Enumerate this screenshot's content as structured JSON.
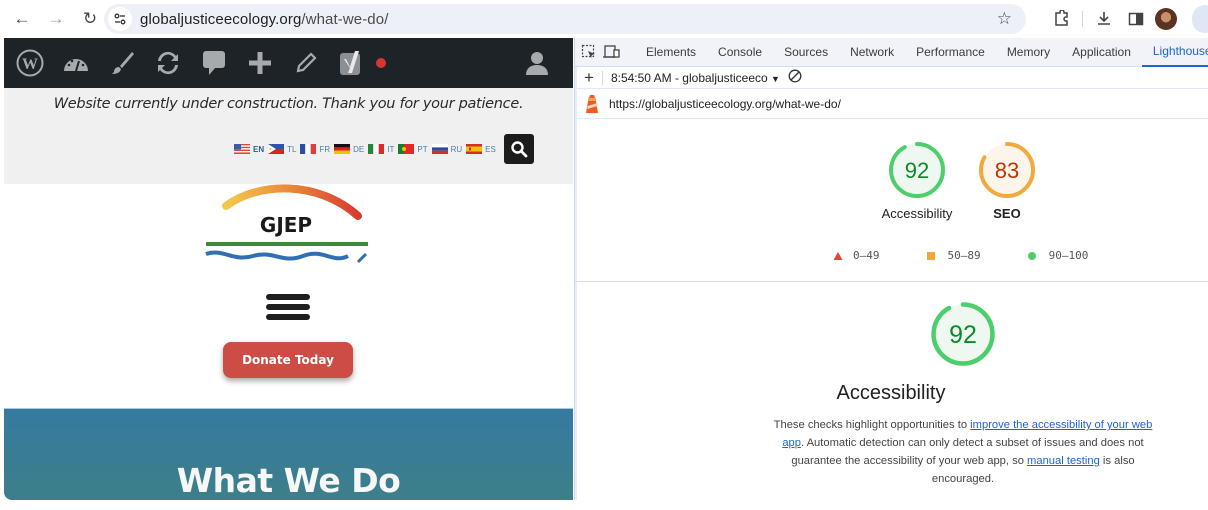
{
  "browser": {
    "url_domain": "globaljusticeecology.org",
    "url_path": "/what-we-do/",
    "icons": [
      "back-icon",
      "forward-icon",
      "reload-icon",
      "site-info-icon",
      "bookmark-star-icon",
      "extensions-icon",
      "download-icon",
      "side-panel-icon",
      "profile-avatar"
    ]
  },
  "page": {
    "admin_bar_icons": [
      "wordpress-icon",
      "dashboard-icon",
      "customize-brush-icon",
      "updates-icon",
      "comments-icon",
      "new-plus-icon",
      "edit-pencil-icon",
      "yoast-seo-icon",
      "seo-status-dot",
      "user-icon"
    ],
    "notice": "Website currently under construction. Thank you for your patience.",
    "languages": [
      {
        "code": "EN",
        "flag": "us-flag-icon",
        "active": true
      },
      {
        "code": "TL",
        "flag": "ph-flag-icon",
        "active": false
      },
      {
        "code": "FR",
        "flag": "fr-flag-icon",
        "active": false
      },
      {
        "code": "DE",
        "flag": "de-flag-icon",
        "active": false
      },
      {
        "code": "IT",
        "flag": "it-flag-icon",
        "active": false
      },
      {
        "code": "PT",
        "flag": "pt-flag-icon",
        "active": false
      },
      {
        "code": "RU",
        "flag": "ru-flag-icon",
        "active": false
      },
      {
        "code": "ES",
        "flag": "es-flag-icon",
        "active": false
      }
    ],
    "logo_text": "GJEP",
    "donate_label": "Donate Today",
    "hero_title": "What We Do",
    "colors": {
      "donate": "#cd4c45",
      "hero_top": "#367aa0",
      "hero_bottom": "#3d7f87",
      "admin_bar": "#1d2327"
    }
  },
  "devtools": {
    "tabs": [
      {
        "label": "Elements",
        "active": false
      },
      {
        "label": "Console",
        "active": false
      },
      {
        "label": "Sources",
        "active": false
      },
      {
        "label": "Network",
        "active": false
      },
      {
        "label": "Performance",
        "active": false
      },
      {
        "label": "Memory",
        "active": false
      },
      {
        "label": "Application",
        "active": false
      },
      {
        "label": "Lighthouse",
        "active": true
      }
    ],
    "report_selector": "8:54:50 AM - globaljusticeeco",
    "report_url": "https://globaljusticeecology.org/what-we-do/",
    "scores": [
      {
        "label": "Accessibility",
        "value": 92,
        "status": "pass",
        "color": "#0c8a29",
        "ring": "#4cce6a",
        "fill": "#eef8f0"
      },
      {
        "label": "SEO",
        "value": 83,
        "status": "average",
        "color": "#c33300",
        "ring": "#f0a93d",
        "fill": "#fdf5ea"
      }
    ],
    "legend": [
      {
        "range": "0–49",
        "shape": "triangle",
        "color": "#e6413a"
      },
      {
        "range": "50–89",
        "shape": "square",
        "color": "#f0a93d"
      },
      {
        "range": "90–100",
        "shape": "circle",
        "color": "#4cce6a"
      }
    ],
    "detail": {
      "score": 92,
      "title": "Accessibility",
      "desc_1": "These checks highlight opportunities to ",
      "link_1": "improve the accessibility of your web app",
      "desc_2": ". Automatic detection can only detect a subset of issues and does not guarantee the accessibility of your web app, so ",
      "link_2": "manual testing",
      "desc_3": " is also encouraged."
    }
  }
}
